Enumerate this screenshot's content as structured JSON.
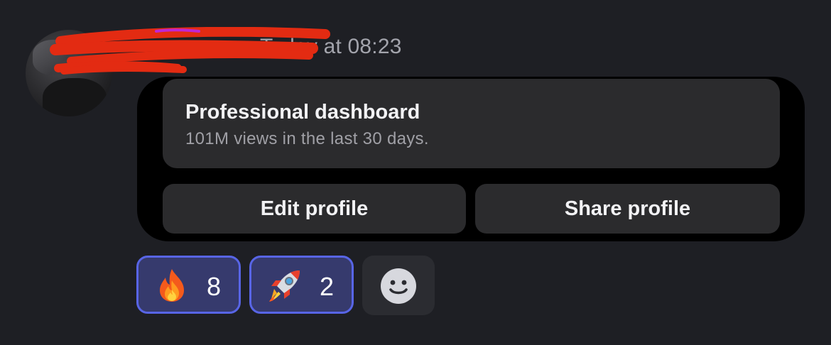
{
  "message": {
    "timestamp": "Today at 08:23"
  },
  "card": {
    "dashboard_title": "Professional dashboard",
    "dashboard_subtitle": "101M views in the last 30 days.",
    "edit_label": "Edit profile",
    "share_label": "Share profile"
  },
  "reactions": [
    {
      "icon": "fire-emoji-icon",
      "count": "8",
      "selected": true
    },
    {
      "icon": "rocket-emoji-icon",
      "count": "2",
      "selected": true
    }
  ],
  "add_reaction": {
    "icon": "smiley-add-reaction-icon"
  },
  "colors": {
    "background": "#1e1f24",
    "card": "#000000",
    "button": "#2b2b2d",
    "reaction_border": "#5865e6",
    "reaction_fill": "#363a6d",
    "redaction": "#e32b12",
    "timestamp": "#a3a4ac"
  }
}
